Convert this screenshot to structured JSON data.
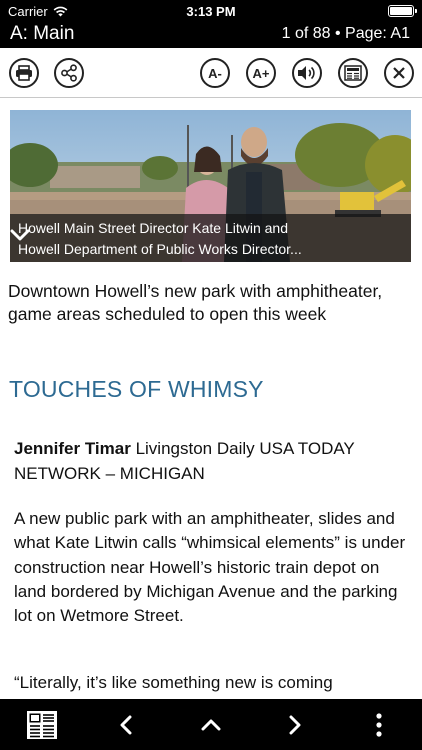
{
  "status_bar": {
    "carrier": "Carrier",
    "time": "3:13 PM"
  },
  "title_bar": {
    "section": "A: Main",
    "page_info": "1 of 88 • Page: A1"
  },
  "toolbar": {
    "print_icon": "printer-icon",
    "share_icon": "share-icon",
    "font_smaller_label": "A-",
    "font_larger_label": "A+",
    "audio_icon": "speaker-icon",
    "page_view_icon": "newspaper-icon",
    "close_icon": "close-icon"
  },
  "article": {
    "photo_caption_line1": "Howell Main Street Director Kate Litwin and",
    "photo_caption_line2": "Howell Department of Public Works Director...",
    "dek": "Downtown Howell’s new park with amphitheater, game areas scheduled to open this week",
    "headline": "TOUCHES OF WHIMSY",
    "author": "Jennifer Timar",
    "byline_rest": " Livingston Daily USA TODAY NETWORK – MICHIGAN",
    "paragraphs": [
      "A new public park with an amphitheater, slides and what Kate Litwin calls “whimsical elements” is under construction near Howell’s historic train depot on land bordered by Michigan Avenue and the parking lot on Wetmore Street.",
      "“Literally, it’s like something new is coming"
    ]
  },
  "bottom_bar": {
    "pages_icon": "page-thumbnails-icon",
    "prev_icon": "chevron-left-icon",
    "up_icon": "chevron-up-icon",
    "next_icon": "chevron-right-icon",
    "more_icon": "more-vertical-icon"
  },
  "colors": {
    "headline": "#2d6a92",
    "bars": "#000000"
  }
}
